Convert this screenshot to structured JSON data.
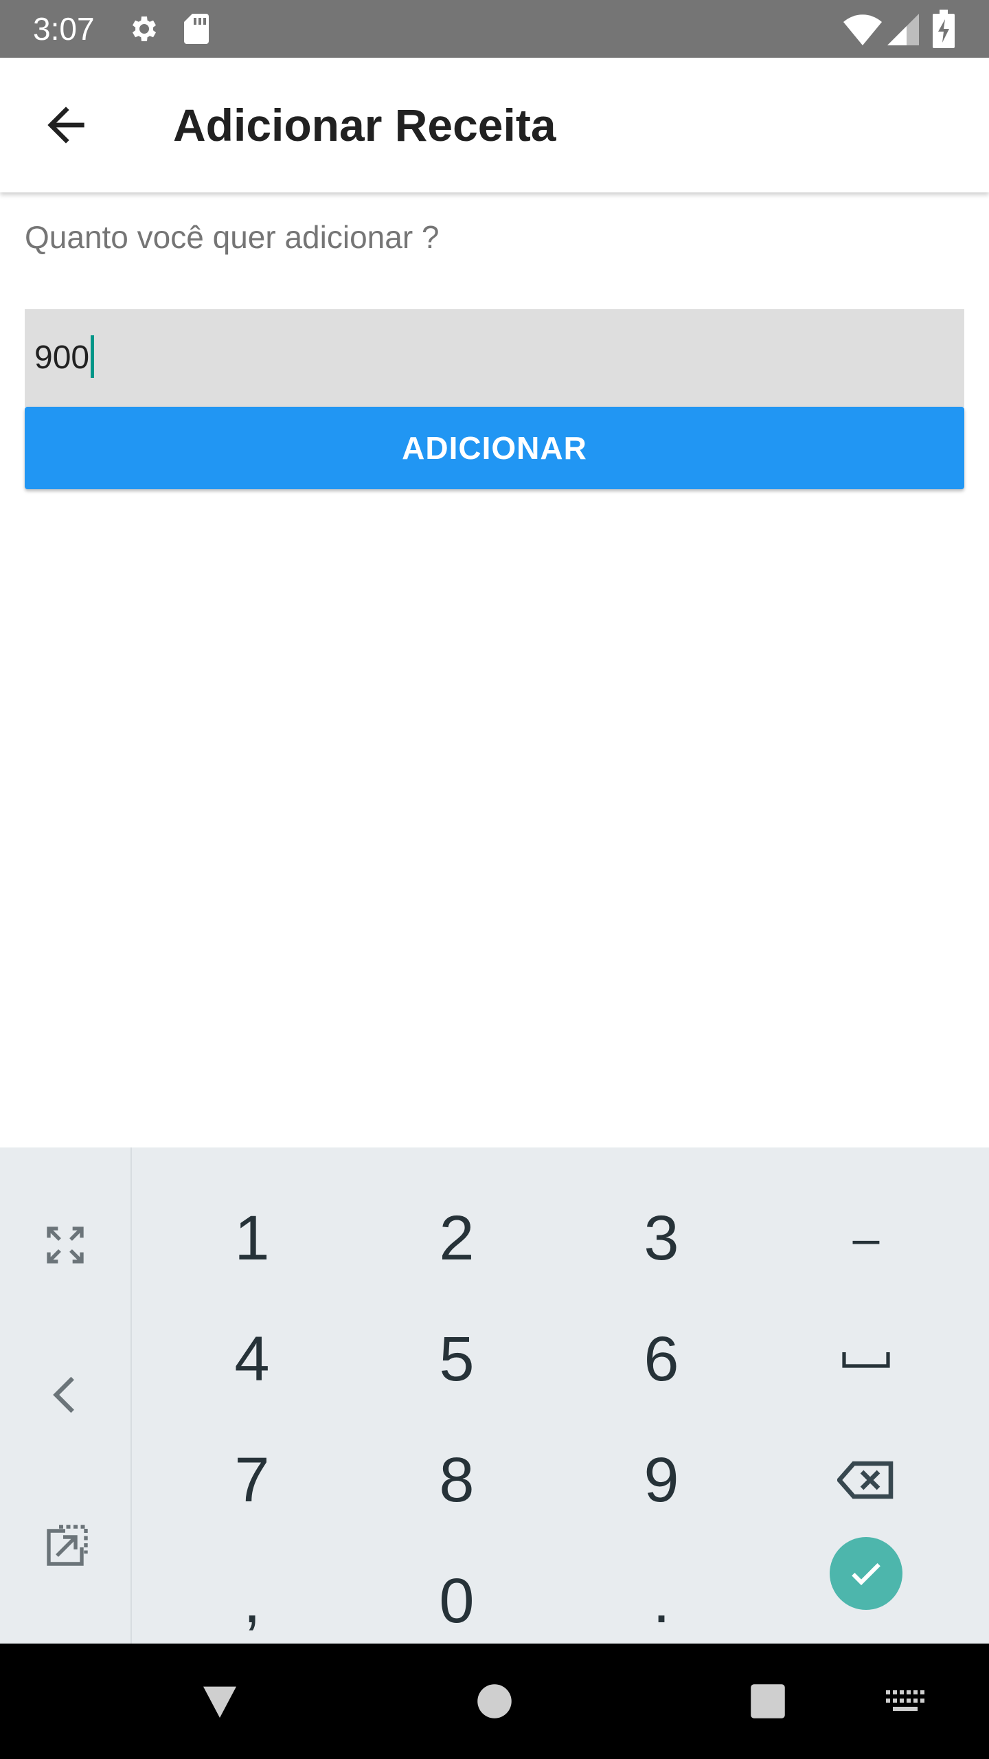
{
  "status_bar": {
    "time": "3:07",
    "icons": [
      "gear-icon",
      "sd-card-icon",
      "wifi-icon",
      "signal-icon",
      "battery-charging-icon"
    ]
  },
  "app_bar": {
    "title": "Adicionar Receita",
    "back_icon": "arrow-left-icon"
  },
  "form": {
    "prompt": "Quanto você quer adicionar ?",
    "amount_value": "900",
    "submit_label": "ADICIONAR"
  },
  "keyboard": {
    "side_keys": [
      "expand-icon",
      "chevron-left-icon",
      "popout-icon"
    ],
    "rows": [
      [
        "1",
        "2",
        "3",
        "–"
      ],
      [
        "4",
        "5",
        "6",
        "␣"
      ],
      [
        "7",
        "8",
        "9",
        "⌫"
      ],
      [
        ",",
        "0",
        ".",
        "✓"
      ]
    ]
  },
  "nav_bar": {
    "icons": [
      "back-triangle-icon",
      "home-circle-icon",
      "recents-square-icon",
      "keyboard-switch-icon"
    ]
  },
  "colors": {
    "status_bar_bg": "#757575",
    "primary": "#2196f3",
    "input_bg": "#dedede",
    "caret": "#009688",
    "keyboard_bg": "#e8ecef",
    "enter_key": "#4db6ac",
    "nav_bar_bg": "#000000"
  }
}
